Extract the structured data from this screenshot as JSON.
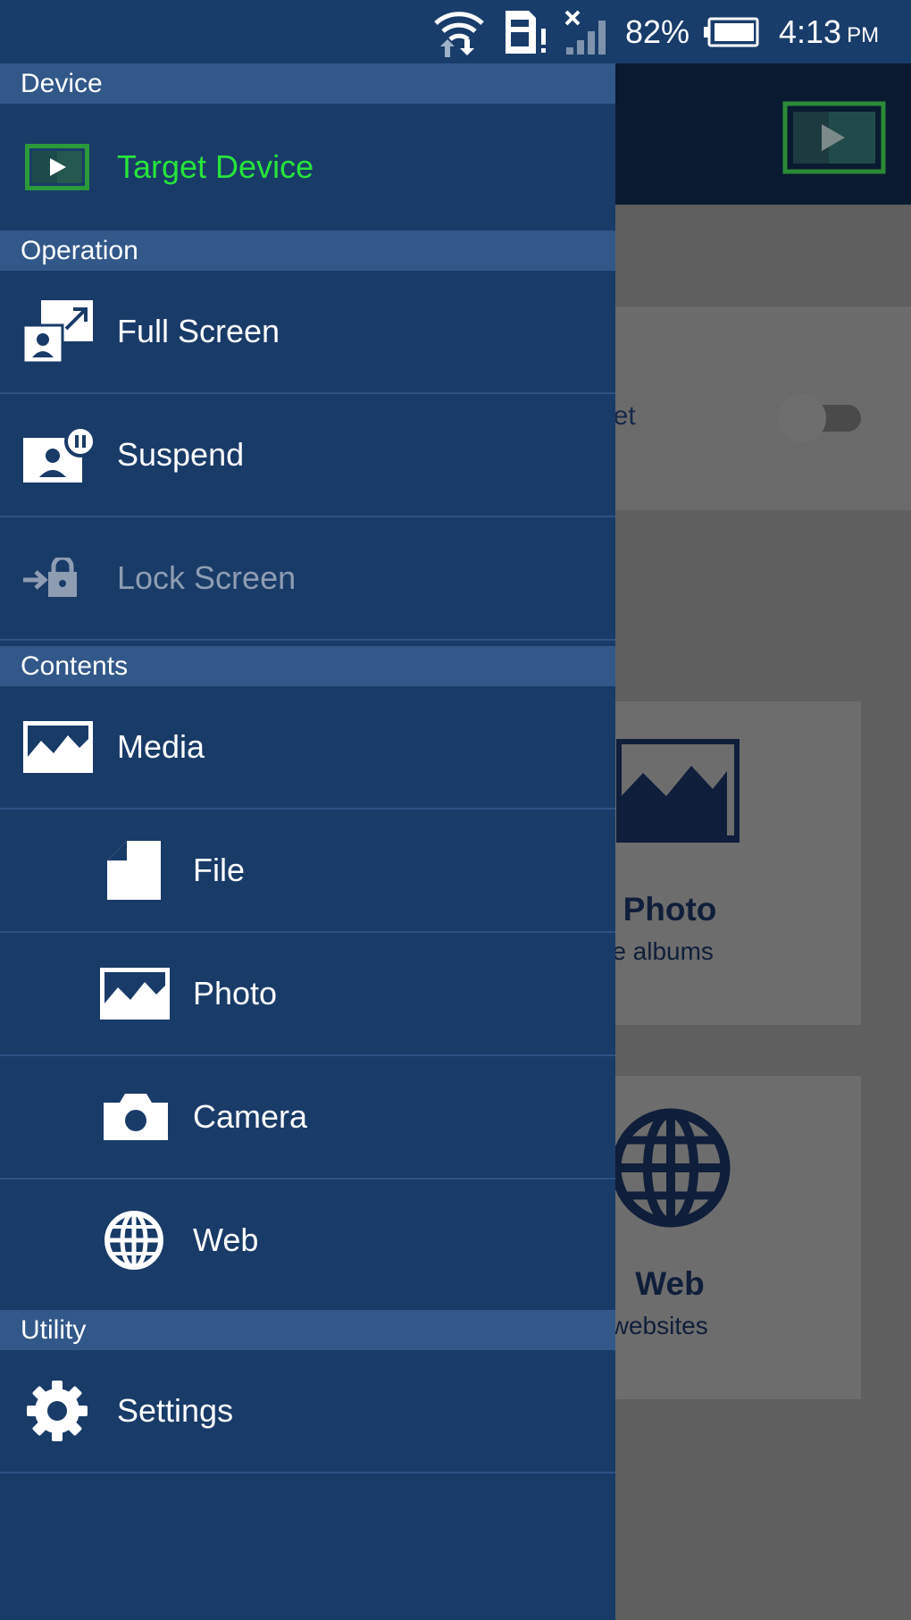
{
  "status_bar": {
    "battery": "82%",
    "time": "4:13",
    "ampm": "PM",
    "icons": [
      "wifi-icon",
      "sim-alert-icon",
      "signal-icon",
      "battery-icon"
    ]
  },
  "background": {
    "panel_label": "rget",
    "cards": [
      {
        "title": "Photo",
        "subtitle": "o in the albums",
        "icon": "image-icon"
      },
      {
        "title": "Web",
        "subtitle": "es of websites",
        "icon": "globe-icon"
      }
    ]
  },
  "drawer": {
    "sections": [
      {
        "header": "Device",
        "items": [
          {
            "label": "Target Device",
            "icon": "cast-screen-icon",
            "selected": true
          }
        ]
      },
      {
        "header": "Operation",
        "items": [
          {
            "label": "Full Screen",
            "icon": "fullscreen-icon"
          },
          {
            "label": "Suspend",
            "icon": "pause-screen-icon"
          },
          {
            "label": "Lock Screen",
            "icon": "lock-icon",
            "disabled": true
          }
        ]
      },
      {
        "header": "Contents",
        "items": [
          {
            "label": "Media",
            "icon": "image-icon"
          },
          {
            "label": "File",
            "icon": "file-icon"
          },
          {
            "label": "Photo",
            "icon": "image-icon"
          },
          {
            "label": "Camera",
            "icon": "camera-icon"
          },
          {
            "label": "Web",
            "icon": "globe-icon"
          }
        ]
      },
      {
        "header": "Utility",
        "items": [
          {
            "label": "Settings",
            "icon": "gear-icon"
          }
        ]
      }
    ]
  },
  "colors": {
    "drawer_bg": "#193b68",
    "section_header_bg": "#325889",
    "selected_text": "#27e43b",
    "disabled_text": "#8e9db2",
    "status_bar_bg": "#193d6a"
  }
}
